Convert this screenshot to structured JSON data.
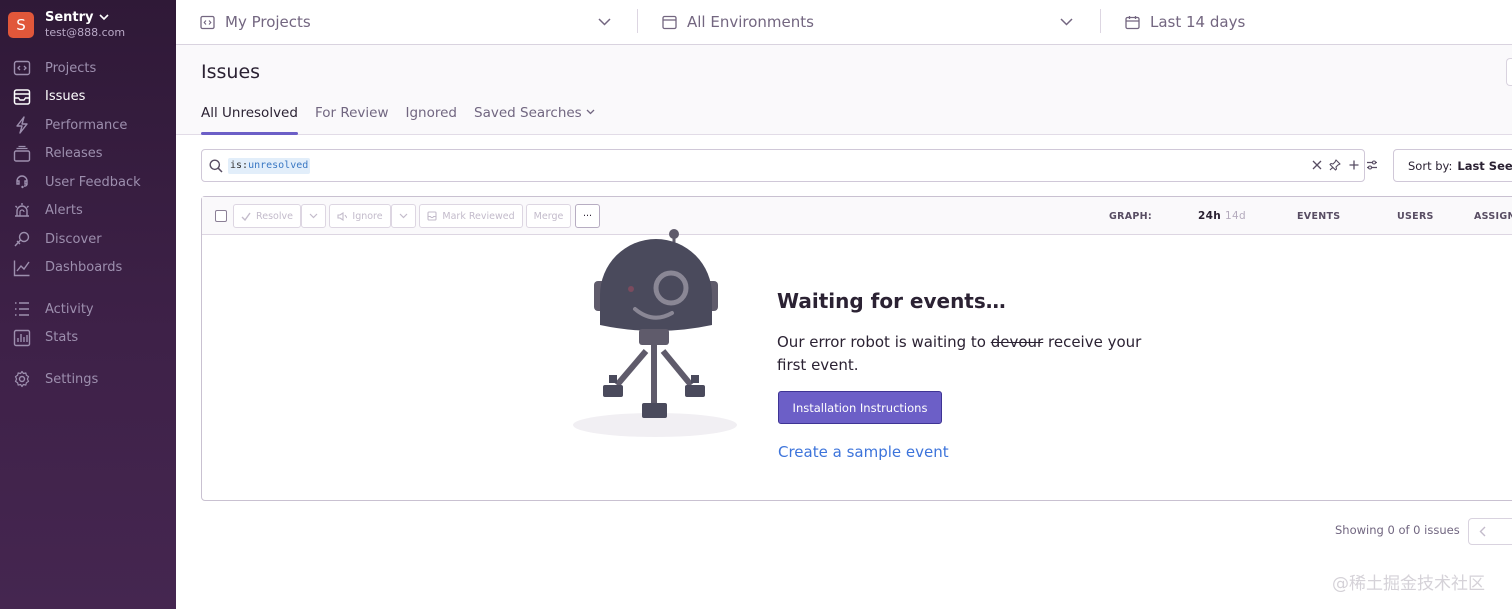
{
  "org": {
    "avatar_letter": "S",
    "name": "Sentry",
    "email": "test@888.com"
  },
  "sidebar": {
    "items": [
      {
        "label": "Projects",
        "icon": "projects-icon"
      },
      {
        "label": "Issues",
        "icon": "issues-icon",
        "active": true
      },
      {
        "label": "Performance",
        "icon": "performance-icon"
      },
      {
        "label": "Releases",
        "icon": "releases-icon"
      },
      {
        "label": "User Feedback",
        "icon": "user-feedback-icon"
      },
      {
        "label": "Alerts",
        "icon": "alerts-icon"
      },
      {
        "label": "Discover",
        "icon": "discover-icon"
      },
      {
        "label": "Dashboards",
        "icon": "dashboards-icon"
      },
      {
        "label": "Activity",
        "icon": "activity-icon"
      },
      {
        "label": "Stats",
        "icon": "stats-icon"
      },
      {
        "label": "Settings",
        "icon": "settings-icon"
      }
    ]
  },
  "header": {
    "projects_label": "My Projects",
    "environments_label": "All Environments",
    "date_label": "Last 14 days"
  },
  "page": {
    "title": "Issues",
    "tabs": [
      {
        "label": "All Unresolved",
        "active": true
      },
      {
        "label": "For Review"
      },
      {
        "label": "Ignored"
      },
      {
        "label": "Saved Searches"
      }
    ]
  },
  "search": {
    "query_key": "is:",
    "query_value": "unresolved"
  },
  "sort": {
    "label": "Sort by:",
    "value": "Last Seen"
  },
  "toolbar": {
    "resolve_label": "Resolve",
    "ignore_label": "Ignore",
    "mark_reviewed_label": "Mark Reviewed",
    "merge_label": "Merge",
    "more_label": "···"
  },
  "columns": {
    "graph_label": "GRAPH:",
    "graph_24h": "24h",
    "graph_14d": "14d",
    "events_label": "EVENTS",
    "users_label": "USERS",
    "assignee_label": "ASSIGNEE"
  },
  "empty_state": {
    "title": "Waiting for events…",
    "message_before": "Our error robot is waiting to ",
    "message_struck": "devour",
    "message_after": " receive your first event.",
    "install_button": "Installation Instructions",
    "sample_link": "Create a sample event"
  },
  "pagination": {
    "showing": "Showing 0 of 0 issues"
  },
  "watermark": "@稀土掘金技术社区",
  "colors": {
    "accent": "#6c5fc7",
    "sidebar_bg": "#3e2148",
    "link": "#3d74db",
    "org_avatar": "#e1573a"
  }
}
